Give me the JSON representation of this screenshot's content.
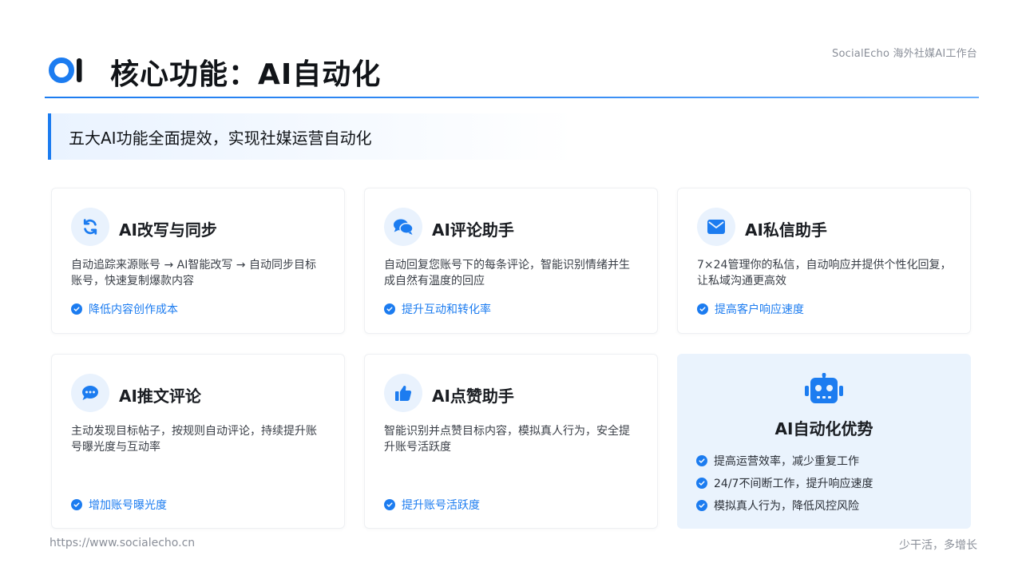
{
  "brand_tag": "SocialEcho 海外社媒AI工作台",
  "page_title": "核心功能：AI自动化",
  "banner": "五大AI功能全面提效，实现社媒运营自动化",
  "colors": {
    "accent": "#1c7cf0",
    "icon_bg": "#e9f2fd",
    "advantage_bg": "#eaf3fd"
  },
  "features": [
    {
      "icon": "sync-icon",
      "title": "AI改写与同步",
      "desc": "自动追踪来源账号 → AI智能改写 → 自动同步目标账号，快速复制爆款内容",
      "benefit": "降低内容创作成本"
    },
    {
      "icon": "comments-icon",
      "title": "AI评论助手",
      "desc": "自动回复您账号下的每条评论，智能识别情绪并生成自然有温度的回应",
      "benefit": "提升互动和转化率"
    },
    {
      "icon": "envelope-icon",
      "title": "AI私信助手",
      "desc": "7×24管理你的私信，自动响应并提供个性化回复，让私域沟通更高效",
      "benefit": "提高客户响应速度"
    },
    {
      "icon": "comment-dots-icon",
      "title": "AI推文评论",
      "desc": "主动发现目标帖子，按规则自动评论，持续提升账号曝光度与互动率",
      "benefit": "增加账号曝光度"
    },
    {
      "icon": "thumbs-up-icon",
      "title": "AI点赞助手",
      "desc": "智能识别并点赞目标内容，模拟真人行为，安全提升账号活跃度",
      "benefit": "提升账号活跃度"
    }
  ],
  "advantages": {
    "icon": "robot-icon",
    "title": "AI自动化优势",
    "items": [
      "提高运营效率，减少重复工作",
      "24/7不间断工作，提升响应速度",
      "模拟真人行为，降低风控风险"
    ]
  },
  "footer": {
    "url": "https://www.socialecho.cn",
    "slogan": "少干活，多增长"
  }
}
